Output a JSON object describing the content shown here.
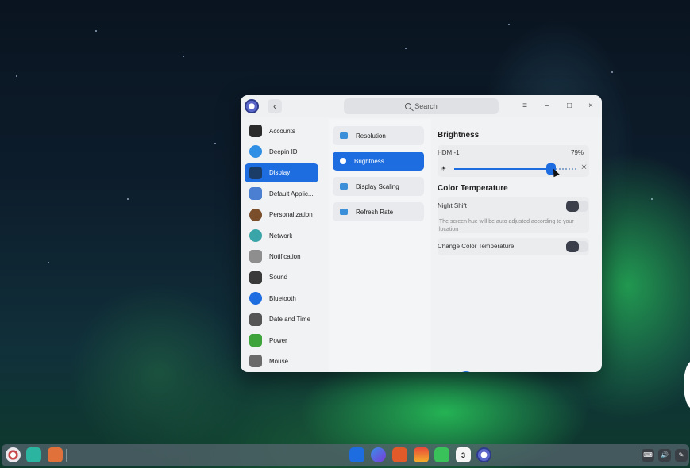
{
  "window": {
    "search_placeholder": "Search",
    "controls": {
      "menu": "≡",
      "minimize": "–",
      "maximize": "□",
      "close": "×"
    },
    "back": "‹"
  },
  "sidebar": {
    "items": [
      {
        "label": "Accounts",
        "icon": "accounts-icon",
        "color": "#2b2b2b"
      },
      {
        "label": "Deepin ID",
        "icon": "cloud-icon",
        "color": "#2f8fe4"
      },
      {
        "label": "Display",
        "icon": "display-icon",
        "color": "#1b3c66",
        "active": true
      },
      {
        "label": "Default Applic...",
        "icon": "default-apps-icon",
        "color": "#4a7fd1"
      },
      {
        "label": "Personalization",
        "icon": "personalization-icon",
        "color": "#7a4e2a"
      },
      {
        "label": "Network",
        "icon": "network-icon",
        "color": "#3aa5a8"
      },
      {
        "label": "Notification",
        "icon": "bell-icon",
        "color": "#8e8e8e"
      },
      {
        "label": "Sound",
        "icon": "speaker-icon",
        "color": "#3a3a3a"
      },
      {
        "label": "Bluetooth",
        "icon": "bluetooth-icon",
        "color": "#1d6ce0"
      },
      {
        "label": "Date and Time",
        "icon": "clock-icon",
        "color": "#555555"
      },
      {
        "label": "Power",
        "icon": "battery-icon",
        "color": "#3ea33a"
      },
      {
        "label": "Mouse",
        "icon": "mouse-icon",
        "color": "#6a6a6a"
      }
    ]
  },
  "display_menu": {
    "items": [
      {
        "label": "Resolution",
        "icon": "resolution-icon"
      },
      {
        "label": "Brightness",
        "icon": "brightness-icon",
        "active": true
      },
      {
        "label": "Display Scaling",
        "icon": "scaling-icon"
      },
      {
        "label": "Refresh Rate",
        "icon": "refresh-rate-icon"
      }
    ],
    "fab_icon": "⊘"
  },
  "brightness": {
    "title": "Brightness",
    "monitor": "HDMI-1",
    "percent_label": "79%",
    "value": 0.79
  },
  "color_temperature": {
    "title": "Color Temperature",
    "night_shift_label": "Night Shift",
    "night_shift_on": false,
    "hint": "The screen hue will be auto adjusted according to your location",
    "change_label": "Change Color Temperature",
    "change_on": false
  },
  "taskbar": {
    "calendar_day": "3",
    "tray": {
      "keyboard": "⌨",
      "volume": "🔊",
      "pen": "✎"
    }
  },
  "colors": {
    "accent": "#1d6ce0",
    "window_bg": "#f1f2f4"
  }
}
